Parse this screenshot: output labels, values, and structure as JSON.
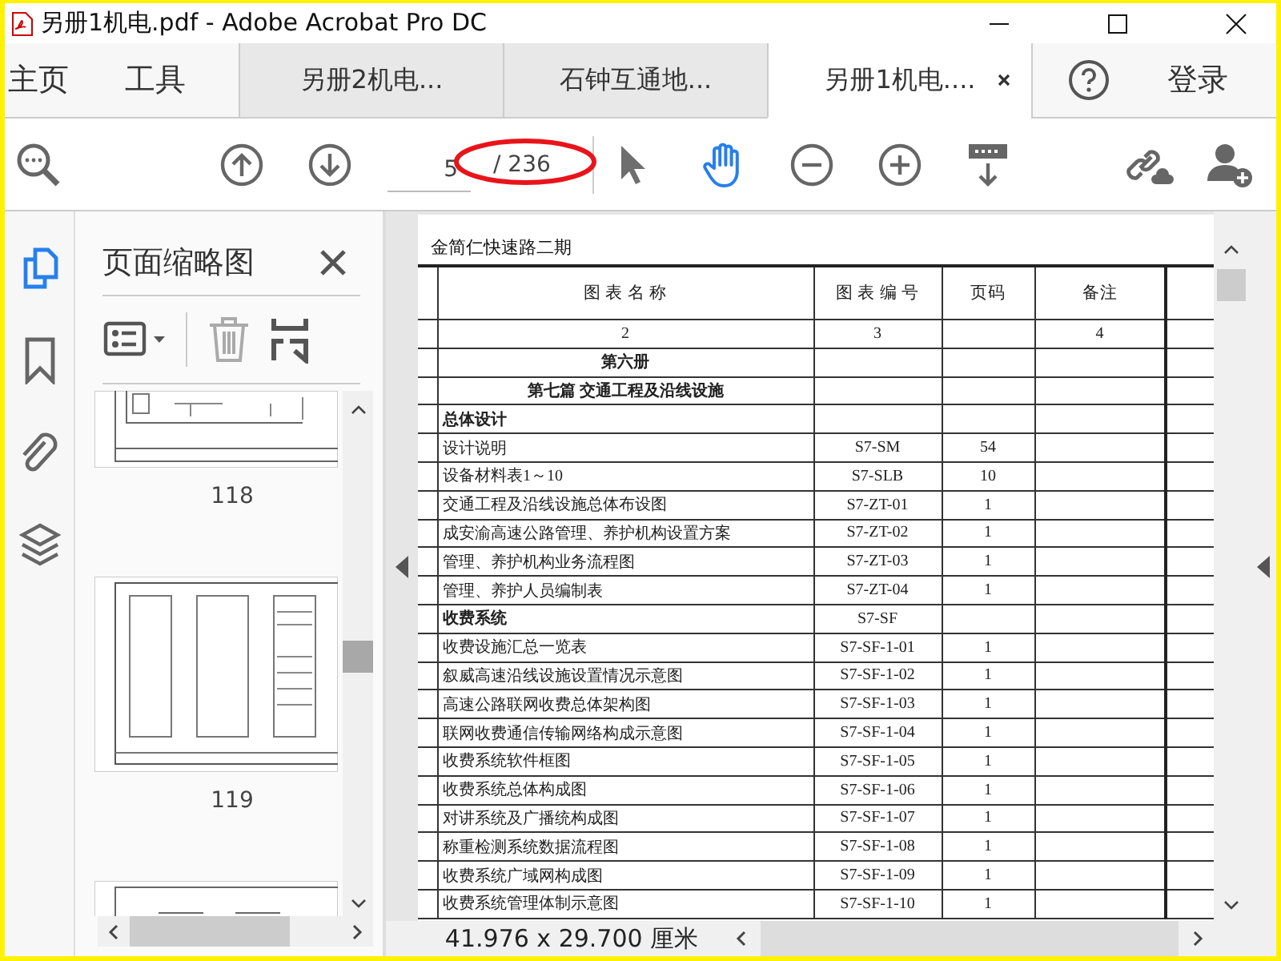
{
  "window": {
    "title": "另册1机电.pdf - Adobe Acrobat Pro DC"
  },
  "tabs": [
    {
      "label": "主页",
      "kind": "nav",
      "selected": false
    },
    {
      "label": "工具",
      "kind": "nav",
      "selected": false
    },
    {
      "label": "另册2机电...",
      "kind": "doc",
      "selected": false
    },
    {
      "label": "石钟互通地...",
      "kind": "doc",
      "selected": false
    },
    {
      "label": "另册1机电....",
      "kind": "doc",
      "selected": true
    }
  ],
  "sign_in": "登录",
  "toolbar": {
    "page_field": {
      "value": "5"
    },
    "page_total": "/ 236",
    "annotation": {
      "kind": "ellipse"
    },
    "tools": [
      {
        "kind": "pointer",
        "selected": false
      },
      {
        "kind": "hand",
        "selected": true
      }
    ]
  },
  "left_rail": [
    {
      "kind": "pages",
      "selected": true
    },
    {
      "kind": "bookmark",
      "selected": false
    },
    {
      "kind": "attachment",
      "selected": false
    },
    {
      "kind": "layers",
      "selected": false
    }
  ],
  "sidebar": {
    "title": "页面缩略图",
    "thumbnails": [
      {
        "kind": "cut_top",
        "label": "118"
      },
      {
        "kind": "full",
        "label": "119"
      },
      {
        "kind": "cut_bottom"
      }
    ]
  },
  "document": {
    "heading": "金简仁快速路二期",
    "columns": [
      "图 表 名 称",
      "图 表 编 号",
      "页码",
      "备注"
    ],
    "rows": [
      {
        "kind": "numbers",
        "name": "2",
        "code": "3",
        "remark": "4"
      },
      {
        "kind": "volume",
        "name": "第六册"
      },
      {
        "kind": "volume",
        "name": "第七篇  交通工程及沿线设施"
      },
      {
        "kind": "group",
        "name": "总体设计"
      },
      {
        "kind": "item",
        "name": "设计说明",
        "code": "S7-SM",
        "page": "54"
      },
      {
        "kind": "item",
        "name": "设备材料表1～10",
        "code": "S7-SLB",
        "page": "10"
      },
      {
        "kind": "item",
        "name": "交通工程及沿线设施总体布设图",
        "code": "S7-ZT-01",
        "page": "1"
      },
      {
        "kind": "item",
        "name": "成安渝高速公路管理、养护机构设置方案",
        "code": "S7-ZT-02",
        "page": "1"
      },
      {
        "kind": "item",
        "name": "管理、养护机构业务流程图",
        "code": "S7-ZT-03",
        "page": "1"
      },
      {
        "kind": "item",
        "name": "管理、养护人员编制表",
        "code": "S7-ZT-04",
        "page": "1"
      },
      {
        "kind": "group",
        "name": "收费系统",
        "code": "S7-SF"
      },
      {
        "kind": "item",
        "name": "收费设施汇总一览表",
        "code": "S7-SF-1-01",
        "page": "1"
      },
      {
        "kind": "item",
        "name": "叙威高速沿线设施设置情况示意图",
        "code": "S7-SF-1-02",
        "page": "1"
      },
      {
        "kind": "item",
        "name": "高速公路联网收费总体架构图",
        "code": "S7-SF-1-03",
        "page": "1"
      },
      {
        "kind": "item",
        "name": "联网收费通信传输网络构成示意图",
        "code": "S7-SF-1-04",
        "page": "1"
      },
      {
        "kind": "item",
        "name": "收费系统软件框图",
        "code": "S7-SF-1-05",
        "page": "1"
      },
      {
        "kind": "item",
        "name": "收费系统总体构成图",
        "code": "S7-SF-1-06",
        "page": "1"
      },
      {
        "kind": "item",
        "name": "对讲系统及广播统构成图",
        "code": "S7-SF-1-07",
        "page": "1"
      },
      {
        "kind": "item",
        "name": "称重检测系统数据流程图",
        "code": "S7-SF-1-08",
        "page": "1"
      },
      {
        "kind": "item",
        "name": "收费系统广域网构成图",
        "code": "S7-SF-1-09",
        "page": "1"
      },
      {
        "kind": "item",
        "name": "收费系统管理体制示意图",
        "code": "S7-SF-1-10",
        "page": "1"
      }
    ]
  },
  "status_bar": {
    "size": "41.976 x 29.700 厘米"
  }
}
